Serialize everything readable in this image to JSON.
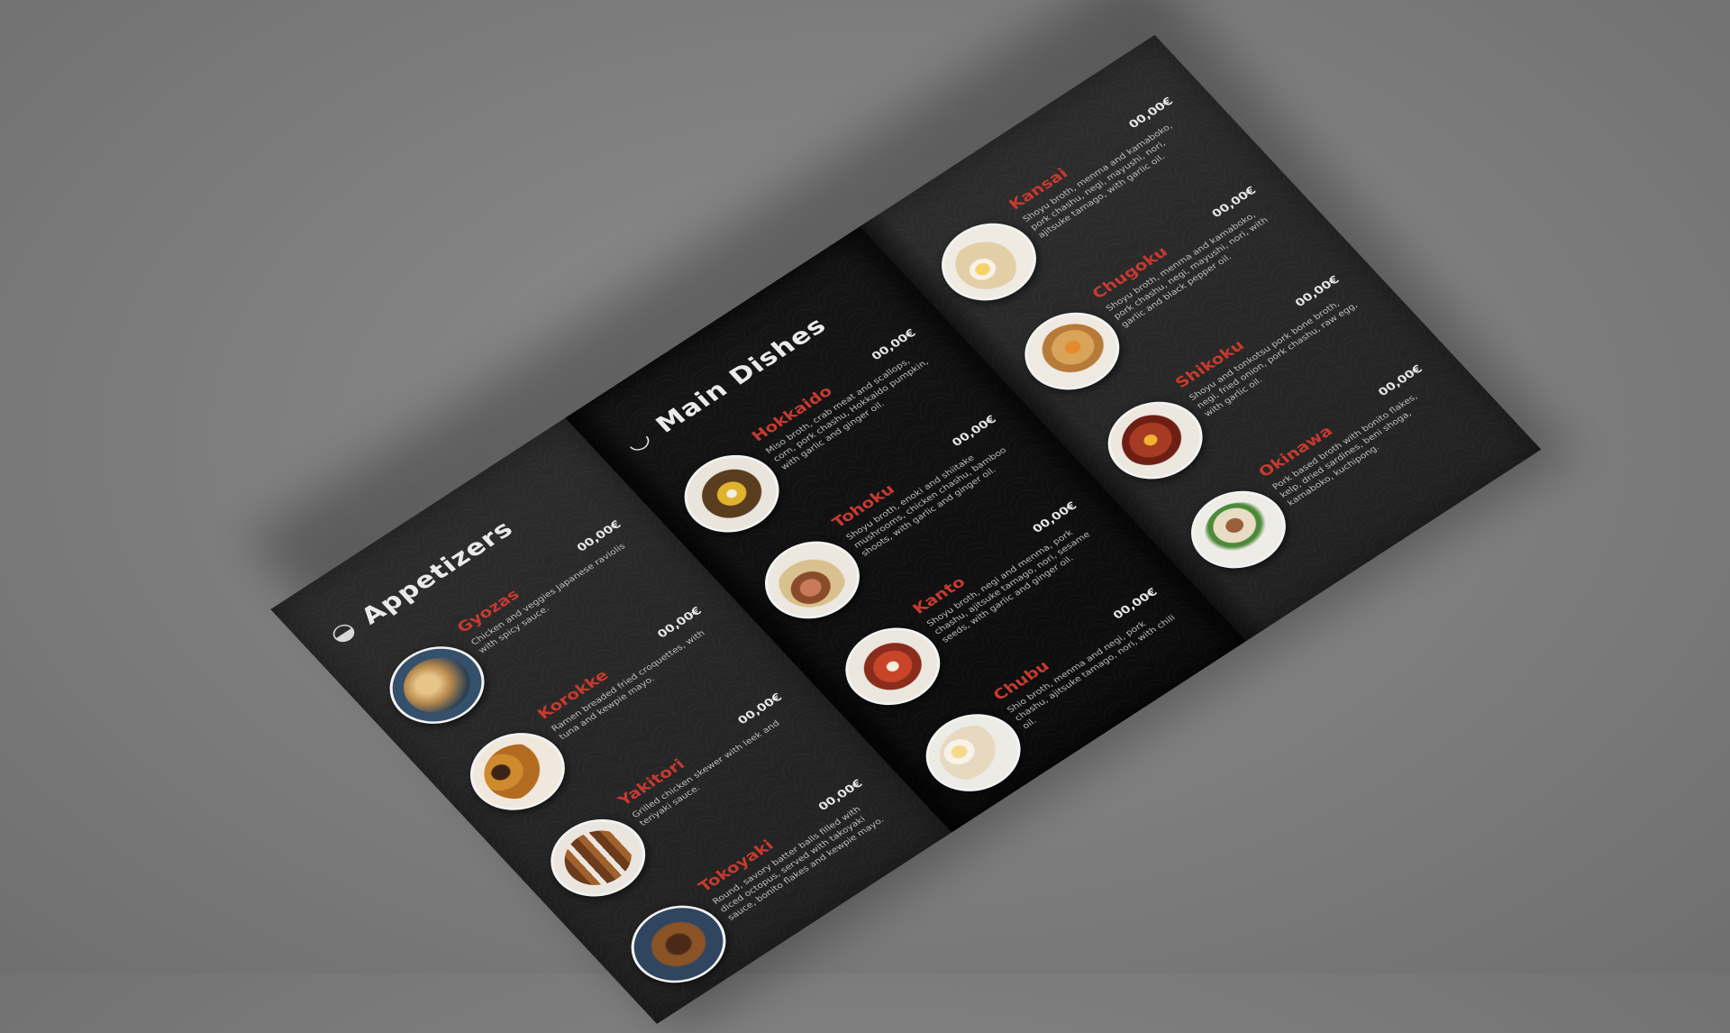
{
  "panels": {
    "appetizers": {
      "title": "Appetizers",
      "icon": "dumpling-icon",
      "items": [
        {
          "name": "Gyozas",
          "price": "00,00€",
          "desc": "Chicken and veggies Japanese raviolis with spicy sauce."
        },
        {
          "name": "Korokke",
          "price": "00,00€",
          "desc": "Ramen breaded fried croquettes, with tuna and kewpie mayo."
        },
        {
          "name": "Yakitori",
          "price": "00,00€",
          "desc": "Grilled chicken skewer with leek and teriyaki sauce."
        },
        {
          "name": "Tokoyaki",
          "price": "00,00€",
          "desc": "Round, savory batter balls filled with diced octopus, served with takoyaki sauce, bonito flakes and kewpie mayo."
        }
      ]
    },
    "main": {
      "title": "Main Dishes",
      "icon": "noodle-bowl-icon",
      "items": [
        {
          "name": "Hokkaido",
          "price": "00,00€",
          "desc": "Miso broth, crab meat and scallops, corn, pork chashu, Hokkaido pumpkin, with garlic and ginger oil."
        },
        {
          "name": "Tohoku",
          "price": "00,00€",
          "desc": "Shoyu broth, enoki and shiitake mushrooms, chicken chashu, bamboo shoots, with garlic and ginger oil."
        },
        {
          "name": "Kanto",
          "price": "00,00€",
          "desc": "Shoyu broth, negi and menma, pork chashu, ajitsuke tamago, nori, sesame seeds, with garlic and ginger oil."
        },
        {
          "name": "Chubu",
          "price": "00,00€",
          "desc": "Shio broth, menma and negi, pork chashu, ajitsuke tamago, nori, with chili oil."
        }
      ]
    },
    "right": {
      "items": [
        {
          "name": "Kansai",
          "price": "00,00€",
          "desc": "Shoyu broth, menma and kamaboko, pork chashu, negi, mayushi, nori, ajitsuke tamago, with garlic oil."
        },
        {
          "name": "Chugoku",
          "price": "00,00€",
          "desc": "Shoyu broth, menma and kamaboko, pork chashu, negi, mayushi, nori, with garlic and black pepper oil."
        },
        {
          "name": "Shikoku",
          "price": "00,00€",
          "desc": "Shoyu and tonkotsu pork bone broth, negi, fried onion, pork chashu, raw egg, with garlic oil."
        },
        {
          "name": "Okinawa",
          "price": "00,00€",
          "desc": "Pork based broth with bonito flakes, kelp, dried sardines, beni shoga, kamaboko, kuchipong."
        }
      ]
    }
  },
  "colors": {
    "accent_red": "#c63a2f",
    "paper_dark": "#242424",
    "paper_black": "#0e0e0e",
    "background": "#7f7f7f"
  }
}
